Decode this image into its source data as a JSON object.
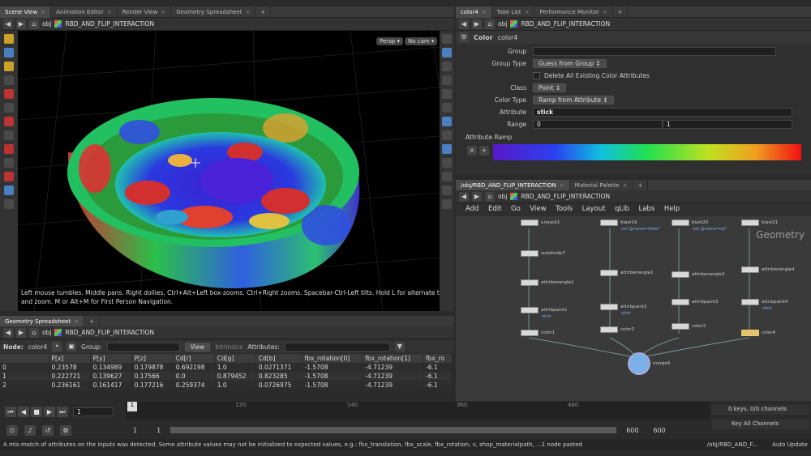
{
  "left_tabs": [
    "Scene View",
    "Animation Editor",
    "Render View",
    "Geometry Spreadsheet"
  ],
  "right_top_tabs": [
    "color4",
    "Take List",
    "Performance Monitor"
  ],
  "network_tabs": [
    "/obj/RBD_AND_FLIP_INTERACTION",
    "Material Palette"
  ],
  "path": {
    "obj": "obj",
    "node_path": "RBD_AND_FLIP_INTERACTION"
  },
  "viewport": {
    "persp": "Persp ▾",
    "cam": "No cam ▾",
    "help1": "Left mouse tumbles. Middle pans. Right dollies. Ctrl+Alt+Left box-zooms. Ctrl+Right zooms. Spacebar-Ctrl-Left tilts. Hold L for alternate tumble, dolly,",
    "help2": "and zoom.     M or Alt+M for First Person Navigation."
  },
  "params": {
    "node_type": "Color",
    "node_name": "color4",
    "group_label": "Group",
    "group_type_label": "Group Type",
    "group_type_value": "Guess from Group ↕",
    "delete_label": "Delete All Existing Color Attributes",
    "class_label": "Class",
    "class_value": "Point ↕",
    "color_type_label": "Color Type",
    "color_type_value": "Ramp from Attribute ↕",
    "attribute_label": "Attribute",
    "attribute_value": "stick",
    "range_label": "Range",
    "range_min": "0",
    "range_max": "1",
    "ramp_label": "Attribute Ramp"
  },
  "network_menu": [
    "Add",
    "Edit",
    "Go",
    "View",
    "Tools",
    "Layout",
    "qLib",
    "Labs",
    "Help"
  ],
  "watermark": "Geometry",
  "nodes": [
    {
      "label": "unpack1",
      "sub": ""
    },
    {
      "label": "subdivide7",
      "sub": ""
    },
    {
      "label": "attribwrangle1",
      "sub": ""
    },
    {
      "label": "attribpaint1",
      "sub": "stick"
    },
    {
      "label": "color1",
      "sub": ""
    },
    {
      "label": "blast19",
      "sub": "not @name=flake*"
    },
    {
      "label": "attribwrangle2",
      "sub": ""
    },
    {
      "label": "attribpaint2",
      "sub": "stick"
    },
    {
      "label": "color2",
      "sub": ""
    },
    {
      "label": "blast20",
      "sub": "not @name=tip*"
    },
    {
      "label": "attribwrangle3",
      "sub": ""
    },
    {
      "label": "attribpaint3",
      "sub": ""
    },
    {
      "label": "color3",
      "sub": ""
    },
    {
      "label": "blast21",
      "sub": ""
    },
    {
      "label": "attribwrangle4",
      "sub": ""
    },
    {
      "label": "attribpaint4",
      "sub": "stick"
    },
    {
      "label": "color4",
      "sub": ""
    },
    {
      "label": "merge9",
      "sub": ""
    }
  ],
  "spreadsheet": {
    "title": "Geometry Spreadsheet",
    "node_label": "Node:",
    "node_value": "color4",
    "group_label": "Group:",
    "view_label": "View",
    "intrinsics_label": "Intrinsics",
    "attributes_label": "Attributes:",
    "columns": [
      "",
      "P[x]",
      "P[y]",
      "P[z]",
      "Cd[r]",
      "Cd[g]",
      "Cd[b]",
      "fbx_rotation[0]",
      "fbx_rotation[1]",
      "fbx_ro"
    ],
    "rows": [
      [
        "0",
        "0.23578",
        "0.134989",
        "0.179878",
        "0.692198",
        "1.0",
        "0.0271371",
        "-1.5708",
        "-4.71239",
        "-6.1"
      ],
      [
        "1",
        "0.222721",
        "0.139627",
        "0.17566",
        "0.0",
        "0.879452",
        "0.823285",
        "-1.5708",
        "-4.71239",
        "-6.1"
      ],
      [
        "2",
        "0.236161",
        "0.161417",
        "0.177216",
        "0.259374",
        "1.0",
        "0.0726975",
        "-1.5708",
        "-4.71239",
        "-6.1"
      ]
    ]
  },
  "timeline": {
    "frame": "1",
    "ticks": [
      "120",
      "240",
      "360",
      "480"
    ],
    "start": "1",
    "start2": "1",
    "end": "600",
    "end2": "600",
    "keys": "0 keys, 0/0 channels",
    "key_all": "Key All Channels"
  },
  "status": {
    "message": "A mis-match of attributes on the inputs was detected.  Some attribute values may not be initialized to expected values, e.g.: fbx_translation, fbx_scale, fbx_rotation, v, shop_materialpath, ...1 node pasted",
    "path": "/obj/RBD_AND_F...",
    "update": "Auto Update"
  }
}
